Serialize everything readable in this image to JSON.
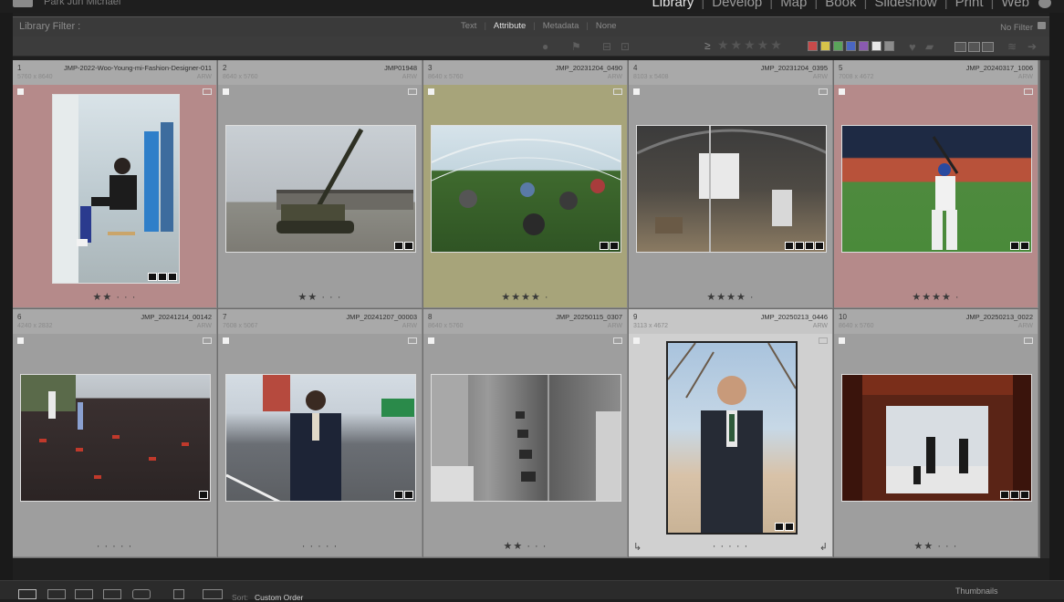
{
  "top": {
    "user_name": "Park Jun Michael",
    "modules": [
      "Library",
      "Develop",
      "Map",
      "Book",
      "Slideshow",
      "Print",
      "Web"
    ],
    "active_module": "Library"
  },
  "filter_bar": {
    "title": "Library Filter :",
    "tabs": [
      "Text",
      "Attribute",
      "Metadata",
      "None"
    ],
    "active_tab": "Attribute",
    "preset": "No Filter"
  },
  "attribute_bar": {
    "rating_operator": "≥",
    "stars": "★★★★★",
    "color_labels": [
      "#c84a4a",
      "#d6c34a",
      "#5aa35a",
      "#4a66c2",
      "#8a5ab0",
      "#e8e8e8",
      "#8c8c8c"
    ]
  },
  "grid": {
    "cells": [
      {
        "index": "1",
        "filename": "JMP-2022-Woo-Young-mi-Fashion-Designer-011",
        "dims": "5760 x 8640",
        "ext": "ARW",
        "stars": "★★ · · ·",
        "bg": "#b58a8a"
      },
      {
        "index": "2",
        "filename": "JMP01948",
        "dims": "8640 x 5760",
        "ext": "ARW",
        "stars": "★★ · · ·",
        "bg": "#9e9e9e"
      },
      {
        "index": "3",
        "filename": "JMP_20231204_0490",
        "dims": "8640 x 5760",
        "ext": "ARW",
        "stars": "★★★★ ·",
        "bg": "#a7a47a"
      },
      {
        "index": "4",
        "filename": "JMP_20231204_0395",
        "dims": "8103 x 5408",
        "ext": "ARW",
        "stars": "★★★★ ·",
        "bg": "#9e9e9e"
      },
      {
        "index": "5",
        "filename": "JMP_20240317_1006",
        "dims": "7008 x 4672",
        "ext": "ARW",
        "stars": "★★★★ ·",
        "bg": "#b58a8a"
      },
      {
        "index": "6",
        "filename": "JMP_20241214_00142",
        "dims": "4240 x 2832",
        "ext": "ARW",
        "stars": "· · · · ·",
        "bg": "#9e9e9e"
      },
      {
        "index": "7",
        "filename": "JMP_20241207_00003",
        "dims": "7608 x 5067",
        "ext": "ARW",
        "stars": "· · · · ·",
        "bg": "#9e9e9e"
      },
      {
        "index": "8",
        "filename": "JMP_20250115_0307",
        "dims": "8640 x 5760",
        "ext": "ARW",
        "stars": "★★ · · ·",
        "bg": "#9e9e9e"
      },
      {
        "index": "9",
        "filename": "JMP_20250213_0446",
        "dims": "3113 x 4672",
        "ext": "ARW",
        "stars": "· · · · ·",
        "bg": "#d0d0d0"
      },
      {
        "index": "10",
        "filename": "JMP_20250213_0022",
        "dims": "8640 x 5760",
        "ext": "ARW",
        "stars": "★★ · · ·",
        "bg": "#9e9e9e"
      }
    ]
  },
  "bottom": {
    "sort_label": "Sort:",
    "sort_value": "Custom Order",
    "thumbnails_label": "Thumbnails"
  }
}
